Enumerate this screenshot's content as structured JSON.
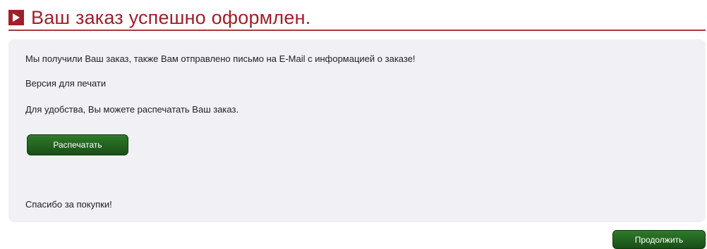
{
  "header": {
    "title": "Ваш заказ успешно оформлен.",
    "icon": "play-arrow-icon",
    "accent_color": "#9e1f2b"
  },
  "panel": {
    "message": "Мы получили Ваш заказ, также Вам отправлено письмо на E-Mail с информацией о заказе!",
    "print_version_label": "Версия для печати",
    "print_hint": "Для удобства, Вы можете распечатать Ваш заказ.",
    "print_button_label": "Распечатать",
    "thanks": "Спасибо за покупки!"
  },
  "footer": {
    "continue_button_label": "Продолжить"
  },
  "colors": {
    "button": "#1f5a1d",
    "panel_background": "#f1f1f5"
  }
}
